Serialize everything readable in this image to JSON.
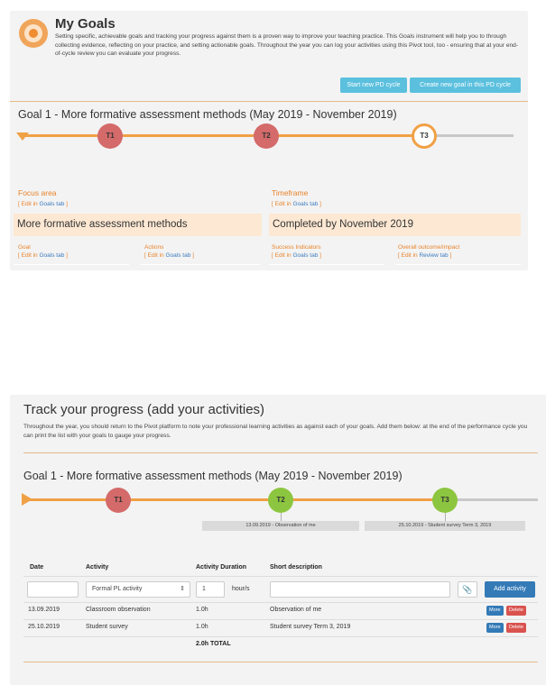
{
  "my_goals": {
    "title": "My Goals",
    "intro": "Setting specific, achievable goals and tracking your progress against them is a proven way to improve your teaching practice. This Goals instrument will help you to through collecting evidence, reflecting on your practice, and setting actionable goals. Throughout the year you can log your activities using this Pivot tool, too - ensuring that at your end-of-cycle review you can evaluate your progress.",
    "start_button": "Start new PD cycle",
    "create_button": "Create new goal in this PD cycle",
    "goal_heading": "Goal 1 - More formative assessment methods (May 2019 - November 2019)",
    "timeline": {
      "t1": "T1",
      "t2": "T2",
      "t3": "T3"
    },
    "focus_area": {
      "label": "Focus area",
      "edit_prefix": "[ Edit in ",
      "edit_link": "Goals tab",
      "edit_suffix": " ]",
      "value": "More formative assessment methods"
    },
    "timeframe": {
      "label": "Timeframe",
      "edit_prefix": "[ Edit in ",
      "edit_link": "Goals tab",
      "edit_suffix": " ]",
      "value": "Completed by November 2019"
    },
    "goal": {
      "label": "Goal",
      "edit_prefix": "[ Edit in ",
      "edit_link": "Goals tab",
      "edit_suffix": " ]"
    },
    "actions": {
      "label": "Actions",
      "edit_prefix": "[ Edit in ",
      "edit_link": "Goals tab",
      "edit_suffix": " ]"
    },
    "success": {
      "label": "Success Indicators",
      "edit_prefix": "[ Edit in ",
      "edit_link": "Goals tab",
      "edit_suffix": " ]"
    },
    "outcome": {
      "label": "Overall outcome/impact",
      "edit_prefix": "[ Edit in ",
      "edit_link": "Review tab",
      "edit_suffix": " ]"
    }
  },
  "track": {
    "title": "Track your progress (add your activities)",
    "intro": "Throughout the year, you should return to the Pivot platform to note your professional learning activities as against each of your goals. Add them below: at the end of the performance cycle you can print the list with your goals to gauge your progress.",
    "goal_heading": "Goal 1 - More formative assessment methods (May 2019 - November 2019)",
    "timeline": {
      "t1": "T1",
      "t2": "T2",
      "t3": "T3",
      "t2_note": "13.09.2019 - Observation of me",
      "t3_note": "25.10.2019 - Student survey Term 3, 2019"
    },
    "table": {
      "headers": {
        "date": "Date",
        "activity": "Activity",
        "duration": "Activity Duration",
        "description": "Short description"
      },
      "input": {
        "date": "",
        "activity": "Formal PL activity",
        "duration": "1",
        "unit": "hour/s",
        "description": ""
      },
      "add_button": "Add activity",
      "attach_icon": "paperclip-icon",
      "rows": [
        {
          "date": "13.09.2019",
          "activity": "Classroom observation",
          "duration": "1.0h",
          "description": "Observation of me",
          "more": "More",
          "delete": "Delete"
        },
        {
          "date": "25.10.2019",
          "activity": "Student survey",
          "duration": "1.0h",
          "description": "Student survey Term 3, 2019",
          "more": "More",
          "delete": "Delete"
        }
      ],
      "total": "2.0h TOTAL"
    }
  },
  "colors": {
    "orange": "#f0a045",
    "red": "#d46a6a",
    "green": "#8cc640",
    "blue": "#337ab7",
    "light_blue": "#5bc0de",
    "danger": "#d9534f"
  }
}
